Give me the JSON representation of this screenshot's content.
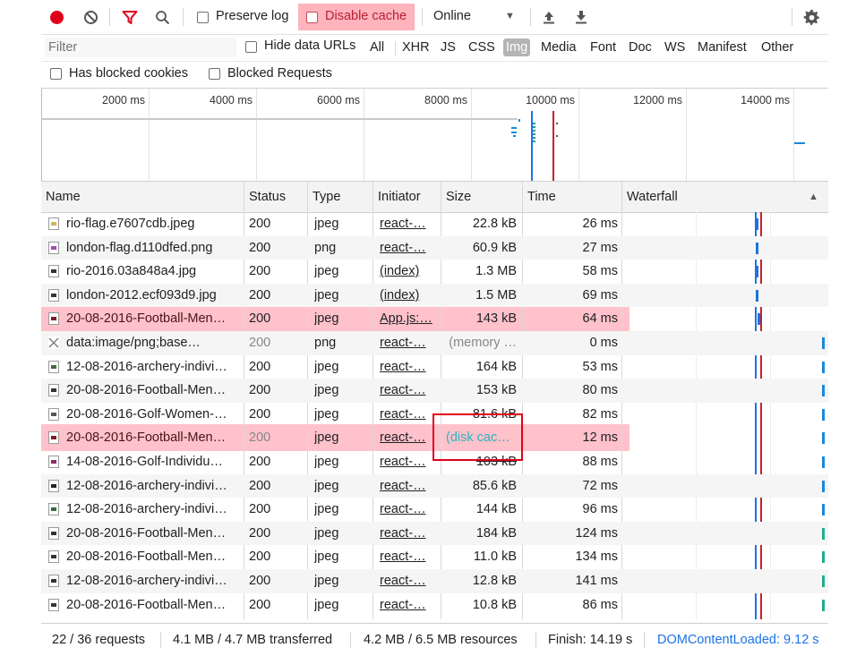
{
  "toolbar": {
    "preserve_log": "Preserve log",
    "disable_cache": "Disable cache",
    "throttle": "Online",
    "throttle_arrow": "▼"
  },
  "filter_bar": {
    "placeholder": "Filter",
    "hide_data_urls": "Hide data URLs",
    "types": [
      "All",
      "XHR",
      "JS",
      "CSS",
      "Img",
      "Media",
      "Font",
      "Doc",
      "WS",
      "Manifest",
      "Other"
    ],
    "active_type": "Img"
  },
  "options": {
    "has_blocked_cookies": "Has blocked cookies",
    "blocked_requests": "Blocked Requests"
  },
  "overview": {
    "ticks": [
      "2000 ms",
      "4000 ms",
      "6000 ms",
      "8000 ms",
      "10000 ms",
      "12000 ms",
      "14000 ms"
    ]
  },
  "table": {
    "headers": {
      "name": "Name",
      "status": "Status",
      "type": "Type",
      "initiator": "Initiator",
      "size": "Size",
      "time": "Time",
      "waterfall": "Waterfall",
      "sort_arrow": "▲"
    },
    "rows": [
      {
        "name": "rio-flag.e7607cdb.jpeg",
        "status": "200",
        "type": "jpeg",
        "initiator": "react-…",
        "size": "22.8 kB",
        "time": "26 ms"
      },
      {
        "name": "london-flag.d110dfed.png",
        "status": "200",
        "type": "png",
        "initiator": "react-…",
        "size": "60.9 kB",
        "time": "27 ms"
      },
      {
        "name": "rio-2016.03a848a4.jpg",
        "status": "200",
        "type": "jpeg",
        "initiator": "(index)",
        "size": "1.3 MB",
        "time": "58 ms"
      },
      {
        "name": "london-2012.ecf093d9.jpg",
        "status": "200",
        "type": "jpeg",
        "initiator": "(index)",
        "size": "1.5 MB",
        "time": "69 ms"
      },
      {
        "name": "20-08-2016-Football-Men…",
        "status": "200",
        "type": "jpeg",
        "initiator": "App.js:…",
        "size": "143 kB",
        "time": "64 ms"
      },
      {
        "name": "data:image/png;base…",
        "status": "200",
        "type": "png",
        "initiator": "react-…",
        "size": "(memory …",
        "time": "0 ms"
      },
      {
        "name": "12-08-2016-archery-indivi…",
        "status": "200",
        "type": "jpeg",
        "initiator": "react-…",
        "size": "164 kB",
        "time": "53 ms"
      },
      {
        "name": "20-08-2016-Football-Men…",
        "status": "200",
        "type": "jpeg",
        "initiator": "react-…",
        "size": "153 kB",
        "time": "80 ms"
      },
      {
        "name": "20-08-2016-Golf-Women-…",
        "status": "200",
        "type": "jpeg",
        "initiator": "react-…",
        "size": "81.6 kB",
        "time": "82 ms"
      },
      {
        "name": "20-08-2016-Football-Men…",
        "status": "200",
        "type": "jpeg",
        "initiator": "react-…",
        "size": "(disk cac…",
        "time": "12 ms"
      },
      {
        "name": "14-08-2016-Golf-Individu…",
        "status": "200",
        "type": "jpeg",
        "initiator": "react-…",
        "size": "103 kB",
        "time": "88 ms"
      },
      {
        "name": "12-08-2016-archery-indivi…",
        "status": "200",
        "type": "jpeg",
        "initiator": "react-…",
        "size": "85.6 kB",
        "time": "72 ms"
      },
      {
        "name": "12-08-2016-archery-indivi…",
        "status": "200",
        "type": "jpeg",
        "initiator": "react-…",
        "size": "144 kB",
        "time": "96 ms"
      },
      {
        "name": "20-08-2016-Football-Men…",
        "status": "200",
        "type": "jpeg",
        "initiator": "react-…",
        "size": "184 kB",
        "time": "124 ms"
      },
      {
        "name": "20-08-2016-Football-Men…",
        "status": "200",
        "type": "jpeg",
        "initiator": "react-…",
        "size": "11.0 kB",
        "time": "134 ms"
      },
      {
        "name": "12-08-2016-archery-indivi…",
        "status": "200",
        "type": "jpeg",
        "initiator": "react-…",
        "size": "12.8 kB",
        "time": "141 ms"
      },
      {
        "name": "20-08-2016-Football-Men…",
        "status": "200",
        "type": "jpeg",
        "initiator": "react-…",
        "size": "10.8 kB",
        "time": "86 ms"
      }
    ]
  },
  "status_bar": {
    "requests": "22 / 36 requests",
    "transferred": "4.1 MB / 4.7 MB transferred",
    "resources": "4.2 MB / 6.5 MB resources",
    "finish": "Finish: 14.19 s",
    "dom_loaded": "DOMContentLoaded: 9.12 s"
  },
  "colors": {
    "highlight": "#ff9aa8",
    "annotation_box": "#e0001b",
    "disk_cache_text": "#2bb3bd",
    "record": "#e0001b",
    "link_blue": "#1a73e8"
  }
}
